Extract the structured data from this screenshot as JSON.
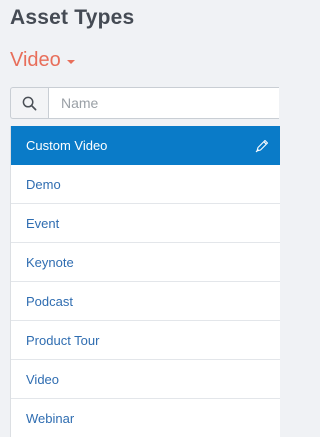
{
  "header": {
    "title": "Asset Types"
  },
  "type_selector": {
    "selected": "Video"
  },
  "search": {
    "placeholder": "Name",
    "value": ""
  },
  "list": {
    "items": [
      {
        "label": "Custom Video",
        "active": true
      },
      {
        "label": "Demo",
        "active": false
      },
      {
        "label": "Event",
        "active": false
      },
      {
        "label": "Keynote",
        "active": false
      },
      {
        "label": "Podcast",
        "active": false
      },
      {
        "label": "Product Tour",
        "active": false
      },
      {
        "label": "Video",
        "active": false
      },
      {
        "label": "Webinar",
        "active": false
      }
    ]
  },
  "icons": {
    "search": "search-icon",
    "caret": "caret-down-icon",
    "edit": "pencil-icon"
  },
  "colors": {
    "accent": "#0a7bc8",
    "selector": "#e86e5a",
    "link": "#2f6db1",
    "title": "#454b54",
    "background": "#f0f2f5"
  }
}
